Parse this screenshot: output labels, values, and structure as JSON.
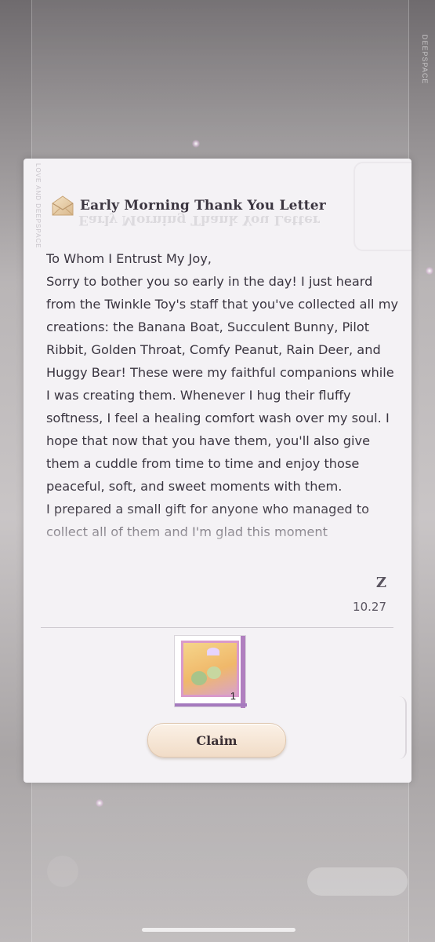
{
  "background": {
    "side_text": "DEEPSPACE"
  },
  "card": {
    "edge_text": "LOVE AND DEEPSPACE",
    "title": "Early Morning Thank You Letter",
    "letter_paragraphs": [
      "To Whom I Entrust My Joy,",
      "Sorry to bother you so early in the day! I just heard from the Twinkle Toy's staff that you've collected all my creations: the Banana Boat, Succulent Bunny, Pilot Ribbit, Golden Throat, Comfy Peanut, Rain Deer, and Huggy Bear! These were my faithful companions while I was creating them. Whenever I hug their fluffy softness, I feel a healing comfort wash over my soul. I hope that now that you have them, you'll also give them a cuddle from time to time and enjoy those peaceful, soft, and sweet moments with them.",
      "I prepared a small gift for anyone who managed to collect all of them and I'm glad this moment"
    ],
    "signature": "Z",
    "date": "10.27",
    "reward": {
      "count": "1"
    },
    "claim_label": "Claim"
  },
  "colors": {
    "accent": "#d99acb",
    "claim_button": "#f1dcc7",
    "text": "#3a3540"
  }
}
